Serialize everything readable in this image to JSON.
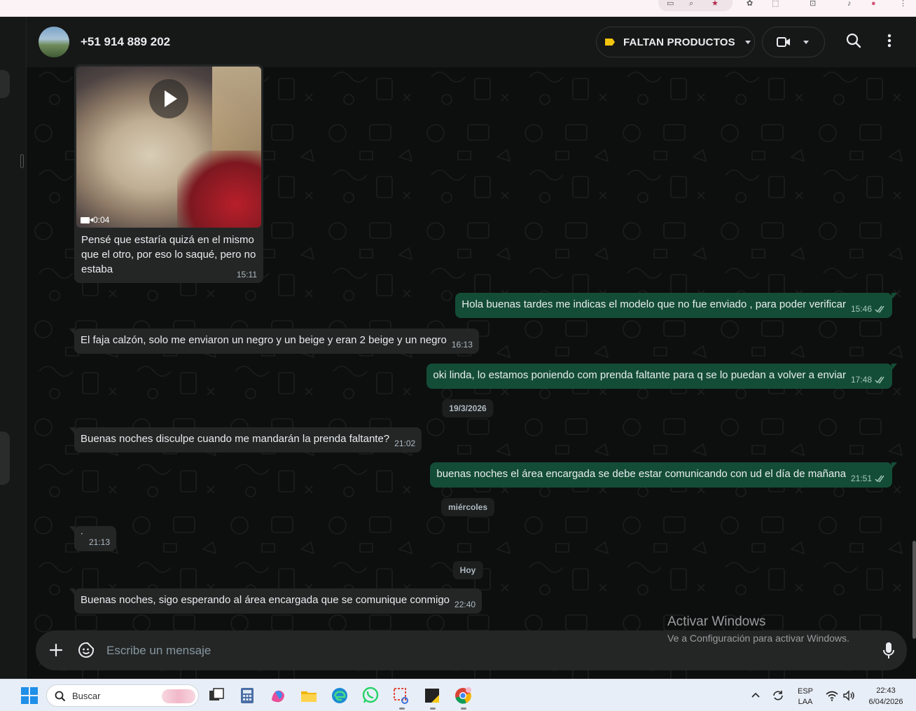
{
  "header": {
    "contact": "+51 914 889 202",
    "label": "FALTAN PRODUCTOS",
    "label_color": "#f1c40f"
  },
  "video_message": {
    "duration": "0:04",
    "caption": "Pensé que estaría quizá en el mismo que el otro, por eso lo saqué, pero no estaba",
    "time": "15:11"
  },
  "messages": [
    {
      "dir": "out",
      "text": "Hola buenas tardes me indicas el modelo que no fue enviado , para poder verificar",
      "time": "15:46"
    },
    {
      "dir": "in",
      "text": "El faja calzón, solo me enviaron un negro y un beige y eran 2 beige y un negro",
      "time": "16:13"
    },
    {
      "dir": "out",
      "text": "oki linda, lo estamos poniendo com prenda faltante para q se lo puedan a volver a enviar",
      "time": "17:48"
    },
    {
      "dir": "in",
      "text": "Buenas noches disculpe cuando me mandarán la prenda faltante?",
      "time": "21:02"
    },
    {
      "dir": "out",
      "text": "buenas noches el área encargada se debe estar comunicando con ud el día de mañana",
      "time": "21:51"
    },
    {
      "dir": "in",
      "text": "˙",
      "time": "21:13"
    },
    {
      "dir": "in",
      "text": "Buenas noches, sigo esperando al área encargada que se comunique conmigo",
      "time": "22:40"
    }
  ],
  "date_dividers": [
    "19/3/2026",
    "miércoles",
    "Hoy"
  ],
  "composer": {
    "placeholder": "Escribe un mensaje"
  },
  "watermark": {
    "title": "Activar Windows",
    "subtitle": "Ve a Configuración para activar Windows."
  },
  "taskbar": {
    "search_placeholder": "Buscar",
    "lang_top": "ESP",
    "lang_bottom": "LAA",
    "time": "22:43",
    "date": "6/04/2026"
  },
  "colors": {
    "outgoing_bubble": "#144d37",
    "incoming_bubble": "#242626",
    "background": "#0d0e0e"
  }
}
